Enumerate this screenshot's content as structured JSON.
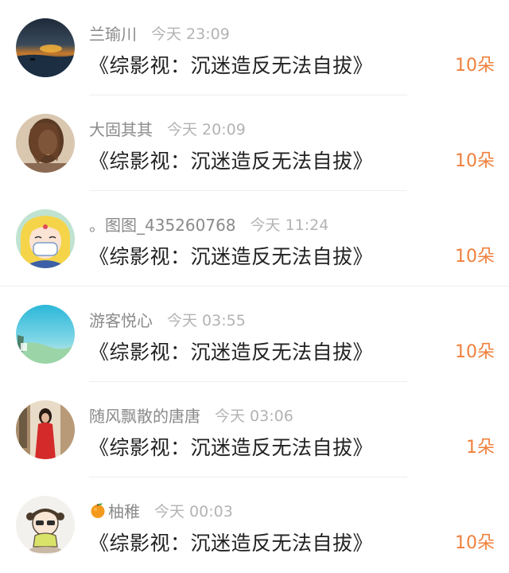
{
  "comments": [
    {
      "username": "兰瑜川",
      "time": "今天 23:09",
      "title": "《综影视：沉迷造反无法自拔》",
      "count": "10朵"
    },
    {
      "username": "大固其其",
      "time": "今天 20:09",
      "title": "《综影视：沉迷造反无法自拔》",
      "count": "10朵"
    },
    {
      "username": "。图图_435260768",
      "time": "今天 11:24",
      "title": "《综影视：沉迷造反无法自拔》",
      "count": "10朵"
    },
    {
      "username": "游客悦心",
      "time": "今天 03:55",
      "title": "《综影视：沉迷造反无法自拔》",
      "count": "10朵"
    },
    {
      "username": "随风飘散的唐唐",
      "time": "今天 03:06",
      "title": "《综影视：沉迷造反无法自拔》",
      "count": "1朵"
    },
    {
      "username": "柚稚",
      "time": "今天 00:03",
      "title": "《综影视：沉迷造反无法自拔》",
      "count": "10朵",
      "name_icon": "orange-fruit-icon"
    }
  ],
  "colors": {
    "username": "#8a8a8a",
    "timestamp": "#b3b3b3",
    "title": "#222222",
    "count_accent": "#f0803c"
  }
}
